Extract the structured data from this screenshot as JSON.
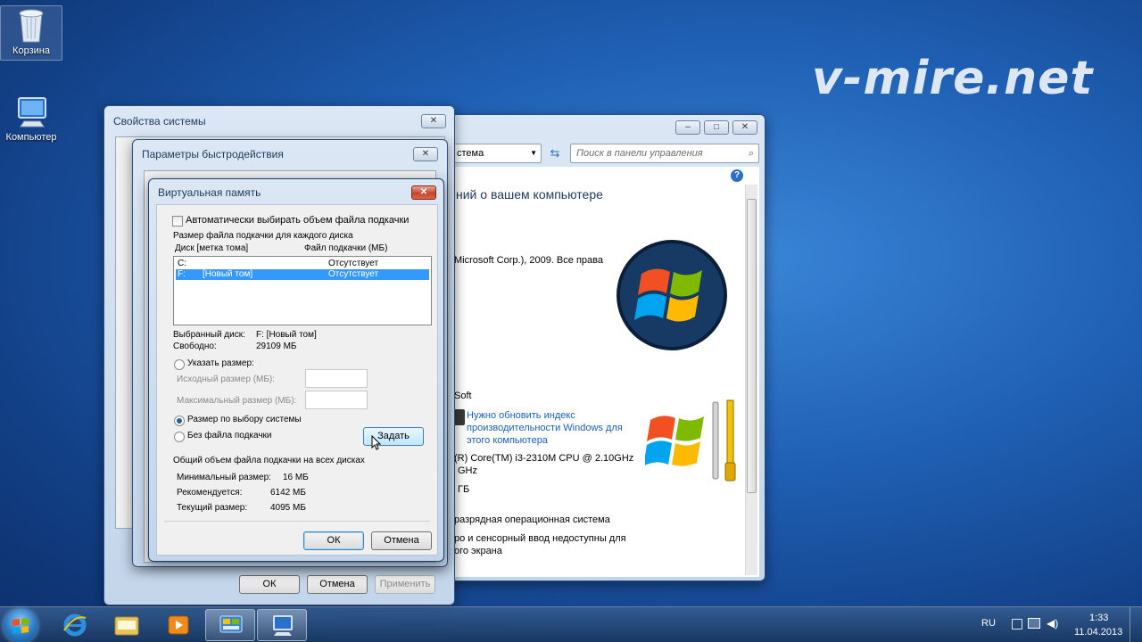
{
  "desktop": {
    "icons": [
      {
        "label": "Корзина",
        "icon": "recycle-bin-icon"
      },
      {
        "label": "Компьютер",
        "icon": "computer-icon"
      }
    ],
    "watermark": "v-mire.net"
  },
  "control_panel": {
    "address_fragment": "стема",
    "search_placeholder": "Поиск в панели управления",
    "heading": "ний о вашем компьютере",
    "copyright": "Microsoft Corp.), 2009. Все права",
    "manufacturer": "Soft",
    "update_link": "Нужно обновить индекс производительности Windows для этого компьютера",
    "processor": "(R) Core(TM) i3-2310M CPU @ 2.10GHz",
    "ghz": "GHz",
    "ram": "ГБ",
    "os_type": "разрядная операционная система",
    "pen_touch": "ро и сенсорный ввод недоступны для",
    "pen_touch2": "ого экрана"
  },
  "system_props": {
    "title": "Свойства системы",
    "ok": "ОК",
    "cancel": "Отмена",
    "apply": "Применить"
  },
  "perf_options": {
    "title": "Параметры быстродействия"
  },
  "virtual_memory": {
    "title": "Виртуальная память",
    "auto_checkbox": "Автоматически выбирать объем файла подкачки",
    "auto_checked": false,
    "section_label": "Размер файла подкачки для каждого диска",
    "col_disk": "Диск [метка тома]",
    "col_file": "Файл подкачки (МБ)",
    "drives": [
      {
        "disk": "C:",
        "label": "",
        "file": "Отсутствует",
        "selected": false
      },
      {
        "disk": "F:",
        "label": "[Новый том]",
        "file": "Отсутствует",
        "selected": true
      }
    ],
    "selected_disk_label": "Выбранный диск:",
    "selected_disk_value": "F:  [Новый том]",
    "free_label": "Свободно:",
    "free_value": "29109 МБ",
    "custom_size": "Указать размер:",
    "initial_size": "Исходный размер (МБ):",
    "max_size": "Максимальный размер (МБ):",
    "system_managed": "Размер по выбору системы",
    "no_paging": "Без файла подкачки",
    "set_button": "Задать",
    "total_heading": "Общий объем файла подкачки на всех дисках",
    "min_label": "Минимальный размер:",
    "min_value": "16 МБ",
    "recommended_label": "Рекомендуется:",
    "recommended_value": "6142 МБ",
    "current_label": "Текущий размер:",
    "current_value": "4095 МБ",
    "ok": "ОК",
    "cancel": "Отмена"
  },
  "taskbar": {
    "lang": "RU",
    "time": "1:33",
    "date": "11.04.2013"
  }
}
